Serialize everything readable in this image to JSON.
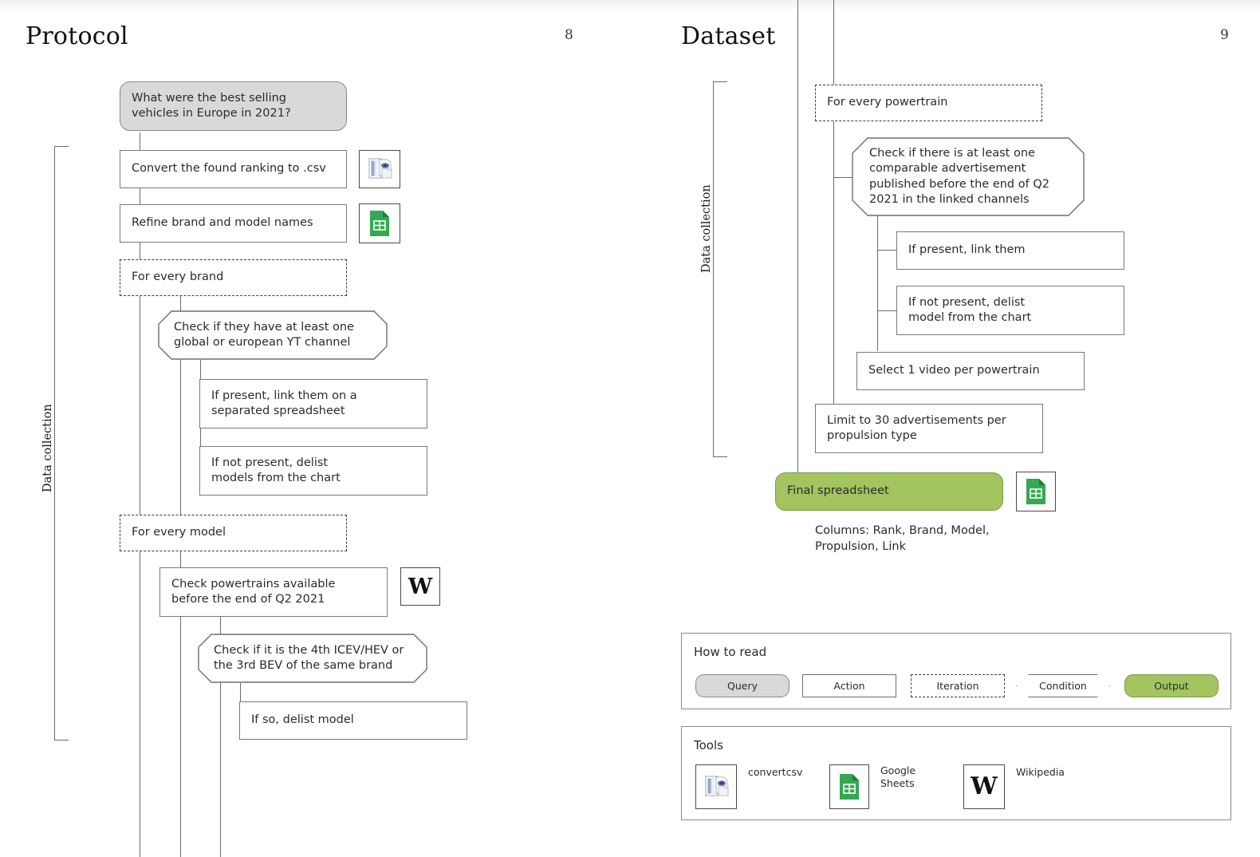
{
  "left_page": {
    "title": "Protocol",
    "page_number": "8",
    "bracket_label": "Data collection",
    "nodes": {
      "query": "What were the best selling\nvehicles in Europe in 2021?",
      "convert": "Convert the found ranking to .csv",
      "refine": "Refine brand and model names",
      "iter_brand": "For every brand",
      "cond_channel": "Check if they have at least one\nglobal or european YT channel",
      "if_present": "If present, link them on a\nseparated spreadsheet",
      "if_not_present": "If not present, delist\nmodels from the chart",
      "iter_model": "For every model",
      "check_powertrains": "Check powertrains available\nbefore the end of Q2 2021",
      "cond_4th": "Check if it is the 4th ICEV/HEV or\nthe 3rd BEV of the same brand",
      "if_so_delist": "If so, delist model"
    },
    "icons": {
      "convert_tool": "convertcsv-icon",
      "refine_tool": "google-sheets-icon",
      "powertrain_tool": "wikipedia-icon",
      "wikipedia_glyph": "W"
    }
  },
  "right_page": {
    "title": "Dataset",
    "page_number": "9",
    "bracket_label": "Data collection",
    "nodes": {
      "iter_powertrain": "For every powertrain",
      "cond_ad": "Check if there is at least one\ncomparable advertisement\npublished before the end of Q2\n2021 in the linked channels",
      "if_present": "If present, link them",
      "if_not_present": "If not present, delist\nmodel from the chart",
      "select_video": "Select 1 video per powertrain",
      "limit_ads": "Limit to 30 advertisements per\npropulsion type",
      "final_spreadsheet": "Final spreadsheet"
    },
    "caption": "Columns: Rank, Brand, Model,\nPropulsion, Link",
    "icons": {
      "final_tool": "google-sheets-icon"
    },
    "how_to_read": {
      "title": "How to read",
      "items": [
        {
          "label": "Query",
          "kind": "query"
        },
        {
          "label": "Action",
          "kind": "action"
        },
        {
          "label": "Iteration",
          "kind": "iteration"
        },
        {
          "label": "Condition",
          "kind": "condition"
        },
        {
          "label": "Output",
          "kind": "output"
        }
      ]
    },
    "tools": {
      "title": "Tools",
      "items": [
        {
          "label": "convertcsv",
          "icon": "convertcsv-icon"
        },
        {
          "label": "Google\nSheets",
          "icon": "google-sheets-icon"
        },
        {
          "label": "Wikipedia",
          "icon": "wikipedia-icon"
        }
      ]
    }
  },
  "colors": {
    "query_fill": "#d9d9d9",
    "output_fill": "#a3c45f",
    "output_stroke": "#7d9a4b",
    "line": "#6b6b6b",
    "sheets_green": "#34a853",
    "text": "#2b2b2b"
  }
}
